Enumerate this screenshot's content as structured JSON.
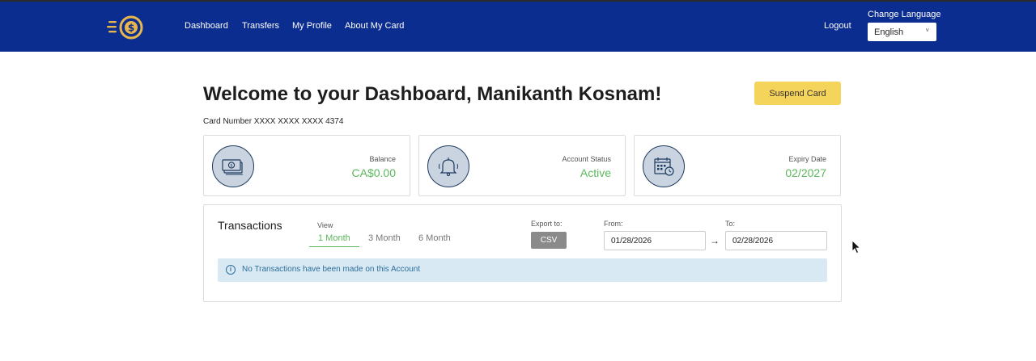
{
  "nav": {
    "links": [
      "Dashboard",
      "Transfers",
      "My Profile",
      "About My Card"
    ],
    "logout": "Logout",
    "language_label": "Change Language",
    "language_value": "English",
    "logo_icon": "dollar-coin-logo-icon"
  },
  "main": {
    "title": "Welcome to your Dashboard, Manikanth Kosnam!",
    "suspend_label": "Suspend Card",
    "card_number": "Card Number XXXX XXXX XXXX 4374",
    "stats": [
      {
        "label": "Balance",
        "value": "CA$0.00",
        "icon": "cash-icon"
      },
      {
        "label": "Account Status",
        "value": "Active",
        "icon": "bell-icon"
      },
      {
        "label": "Expiry Date",
        "value": "02/2027",
        "icon": "calendar-icon"
      }
    ]
  },
  "transactions": {
    "title": "Transactions",
    "view_label": "View",
    "tabs": [
      "1 Month",
      "3 Month",
      "6 Month"
    ],
    "active_tab": "1 Month",
    "export_label": "Export to:",
    "csv_label": "CSV",
    "from_label": "From:",
    "from_value": "01/28/2026",
    "to_label": "To:",
    "to_value": "02/28/2026",
    "notice": "No Transactions have been made on this Account"
  },
  "colors": {
    "navbar": "#0b2d8f",
    "accent_green": "#5cb85c",
    "suspend_yellow": "#f5d45c",
    "notice_bg": "#d9e9f4"
  }
}
